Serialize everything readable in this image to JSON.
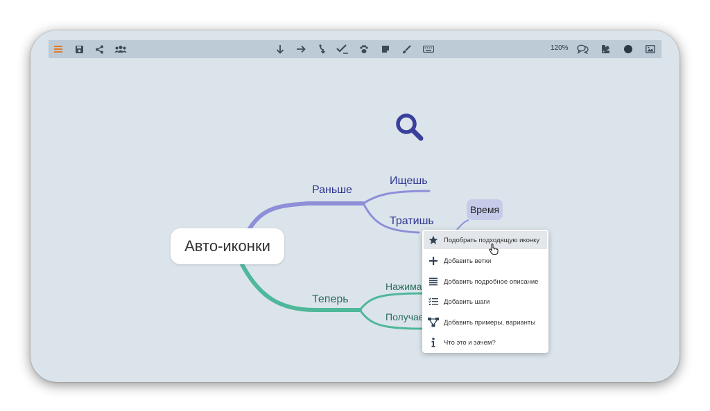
{
  "toolbar": {
    "left_icons": [
      "menu-icon",
      "save-icon",
      "share-icon",
      "users-icon"
    ],
    "center_icons": [
      "arrow-down-icon",
      "arrow-right-icon",
      "branch-icon",
      "check-icon",
      "paw-icon",
      "note-icon",
      "brush-icon",
      "keyboard-icon"
    ],
    "zoom": "120%",
    "right_icons": [
      "comments-icon",
      "palette-icon",
      "circle-icon",
      "image-icon"
    ],
    "colors": {
      "menu_icon": "#e07b2a",
      "icon": "#3a4a58"
    }
  },
  "mindmap": {
    "root": "Авто-иконки",
    "branches": [
      {
        "label": "Раньше",
        "color": "#8e8fd8",
        "children": [
          "Ищешь",
          "Тратишь"
        ]
      },
      {
        "label": "Теперь",
        "color": "#4fb89a",
        "children": [
          "Нажима",
          "Получае"
        ]
      }
    ],
    "tag": "Время",
    "search_icon": "search-icon",
    "colors": {
      "upper_text": "#2f3591",
      "lower_text": "#2d6d5c",
      "search_icon": "#3b3f9c"
    }
  },
  "context_menu": {
    "items": [
      {
        "icon": "star-icon",
        "label": "Подобрать подходящую иконку",
        "active": true
      },
      {
        "icon": "plus-icon",
        "label": "Добавить ветки"
      },
      {
        "icon": "description-icon",
        "label": "Добавить подробное описание"
      },
      {
        "icon": "steps-icon",
        "label": "Добавить шаги"
      },
      {
        "icon": "examples-icon",
        "label": "Добавить примеры, варианты"
      },
      {
        "icon": "info-icon",
        "label": "Что это и зачем?"
      }
    ]
  }
}
